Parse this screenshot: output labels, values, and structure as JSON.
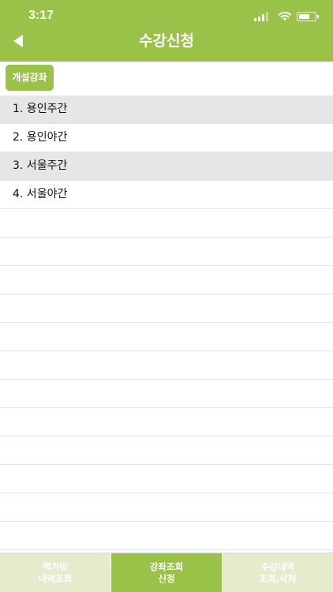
{
  "status_bar": {
    "time": "3:17"
  },
  "header": {
    "title": "수강신청"
  },
  "toolbar": {
    "open_courses_label": "개설강좌"
  },
  "list": {
    "items": [
      {
        "label": "1. 용인주간"
      },
      {
        "label": "2. 용인야간"
      },
      {
        "label": "3. 서울주간"
      },
      {
        "label": "4. 서울야간"
      }
    ]
  },
  "tabs": [
    {
      "line1": "책가방",
      "line2": "내역조회"
    },
    {
      "line1": "강좌조회",
      "line2": "신청"
    },
    {
      "line1": "수강내역",
      "line2": "조회,삭제"
    }
  ],
  "colors": {
    "accent": "#9bc248",
    "tab_inactive": "#e4eccc",
    "row_alt": "#e6e6e6"
  },
  "icons": {
    "back": "back-arrow-icon",
    "signal": "signal-icon",
    "wifi": "wifi-icon",
    "battery": "battery-icon"
  },
  "battery_level": 0.7
}
